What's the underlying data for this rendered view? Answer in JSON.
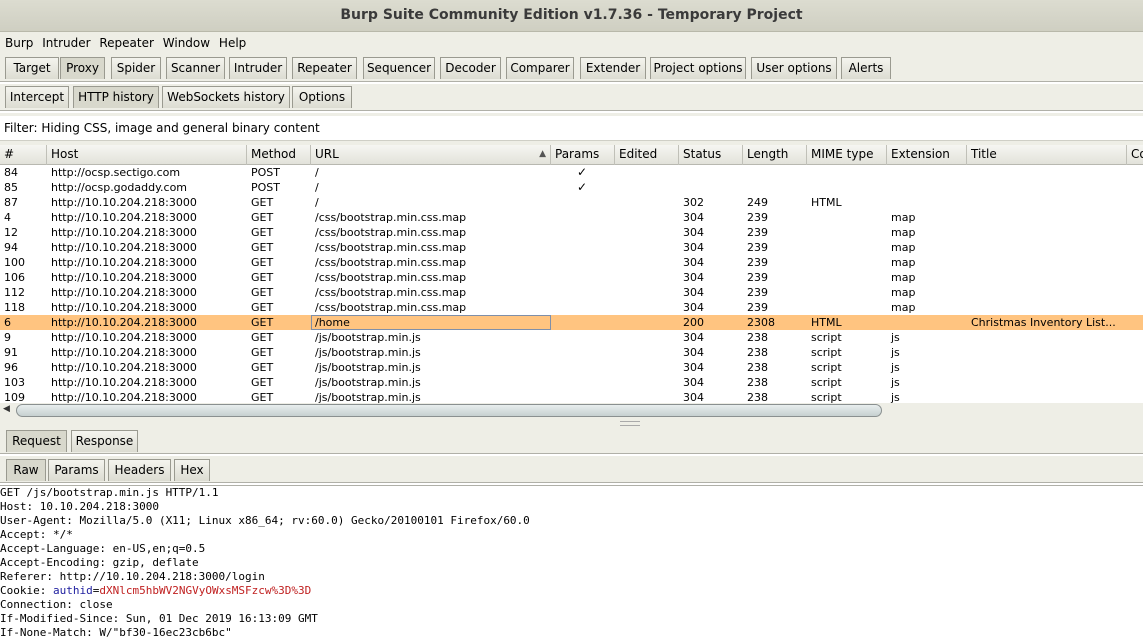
{
  "window": {
    "title": "Burp Suite Community Edition v1.7.36 - Temporary Project"
  },
  "menu": [
    "Burp",
    "Intruder",
    "Repeater",
    "Window",
    "Help"
  ],
  "main_tabs": [
    "Target",
    "Proxy",
    "Spider",
    "Scanner",
    "Intruder",
    "Repeater",
    "Sequencer",
    "Decoder",
    "Comparer",
    "Extender",
    "Project options",
    "User options",
    "Alerts"
  ],
  "main_tabs_active": "Proxy",
  "proxy_tabs": [
    "Intercept",
    "HTTP history",
    "WebSockets history",
    "Options"
  ],
  "proxy_tabs_active": "HTTP history",
  "filter": {
    "text": "Filter: Hiding CSS, image and general binary content"
  },
  "table": {
    "columns": [
      "#",
      "Host",
      "Method",
      "URL",
      "Params",
      "Edited",
      "Status",
      "Length",
      "MIME type",
      "Extension",
      "Title",
      "Co"
    ],
    "sort_indicator": "▲",
    "selected_index": 10,
    "rows": [
      [
        "84",
        "http://ocsp.sectigo.com",
        "POST",
        "/",
        "✓",
        "",
        "",
        "",
        "",
        "",
        ""
      ],
      [
        "85",
        "http://ocsp.godaddy.com",
        "POST",
        "/",
        "✓",
        "",
        "",
        "",
        "",
        "",
        ""
      ],
      [
        "87",
        "http://10.10.204.218:3000",
        "GET",
        "/",
        "",
        "",
        "302",
        "249",
        "HTML",
        "",
        ""
      ],
      [
        "4",
        "http://10.10.204.218:3000",
        "GET",
        "/css/bootstrap.min.css.map",
        "",
        "",
        "304",
        "239",
        "",
        "map",
        ""
      ],
      [
        "12",
        "http://10.10.204.218:3000",
        "GET",
        "/css/bootstrap.min.css.map",
        "",
        "",
        "304",
        "239",
        "",
        "map",
        ""
      ],
      [
        "94",
        "http://10.10.204.218:3000",
        "GET",
        "/css/bootstrap.min.css.map",
        "",
        "",
        "304",
        "239",
        "",
        "map",
        ""
      ],
      [
        "100",
        "http://10.10.204.218:3000",
        "GET",
        "/css/bootstrap.min.css.map",
        "",
        "",
        "304",
        "239",
        "",
        "map",
        ""
      ],
      [
        "106",
        "http://10.10.204.218:3000",
        "GET",
        "/css/bootstrap.min.css.map",
        "",
        "",
        "304",
        "239",
        "",
        "map",
        ""
      ],
      [
        "112",
        "http://10.10.204.218:3000",
        "GET",
        "/css/bootstrap.min.css.map",
        "",
        "",
        "304",
        "239",
        "",
        "map",
        ""
      ],
      [
        "118",
        "http://10.10.204.218:3000",
        "GET",
        "/css/bootstrap.min.css.map",
        "",
        "",
        "304",
        "239",
        "",
        "map",
        ""
      ],
      [
        "6",
        "http://10.10.204.218:3000",
        "GET",
        "/home",
        "",
        "",
        "200",
        "2308",
        "HTML",
        "",
        "Christmas Inventory List..."
      ],
      [
        "9",
        "http://10.10.204.218:3000",
        "GET",
        "/js/bootstrap.min.js",
        "",
        "",
        "304",
        "238",
        "script",
        "js",
        ""
      ],
      [
        "91",
        "http://10.10.204.218:3000",
        "GET",
        "/js/bootstrap.min.js",
        "",
        "",
        "304",
        "238",
        "script",
        "js",
        ""
      ],
      [
        "96",
        "http://10.10.204.218:3000",
        "GET",
        "/js/bootstrap.min.js",
        "",
        "",
        "304",
        "238",
        "script",
        "js",
        ""
      ],
      [
        "103",
        "http://10.10.204.218:3000",
        "GET",
        "/js/bootstrap.min.js",
        "",
        "",
        "304",
        "238",
        "script",
        "js",
        ""
      ],
      [
        "109",
        "http://10.10.204.218:3000",
        "GET",
        "/js/bootstrap.min.js",
        "",
        "",
        "304",
        "238",
        "script",
        "js",
        ""
      ]
    ]
  },
  "message_tabs": [
    "Request",
    "Response"
  ],
  "message_tabs_active": "Request",
  "view_tabs": [
    "Raw",
    "Params",
    "Headers",
    "Hex"
  ],
  "view_tabs_active": "Raw",
  "request": {
    "lines": [
      "GET /js/bootstrap.min.js HTTP/1.1",
      "Host: 10.10.204.218:3000",
      "User-Agent: Mozilla/5.0 (X11; Linux x86_64; rv:60.0) Gecko/20100101 Firefox/60.0",
      "Accept: */*",
      "Accept-Language: en-US,en;q=0.5",
      "Accept-Encoding: gzip, deflate",
      "Referer: http://10.10.204.218:3000/login"
    ],
    "cookie_prefix": "Cookie: ",
    "cookie_name": "authid",
    "cookie_eq": "=",
    "cookie_value": "dXNlcm5hbWV2NGVyOWxsMSFzcw%3D%3D",
    "lines_after": [
      "Connection: close",
      "If-Modified-Since: Sun, 01 Dec 2019 16:13:09 GMT",
      "If-None-Match: W/\"bf30-16ec23cb6bc\""
    ]
  }
}
